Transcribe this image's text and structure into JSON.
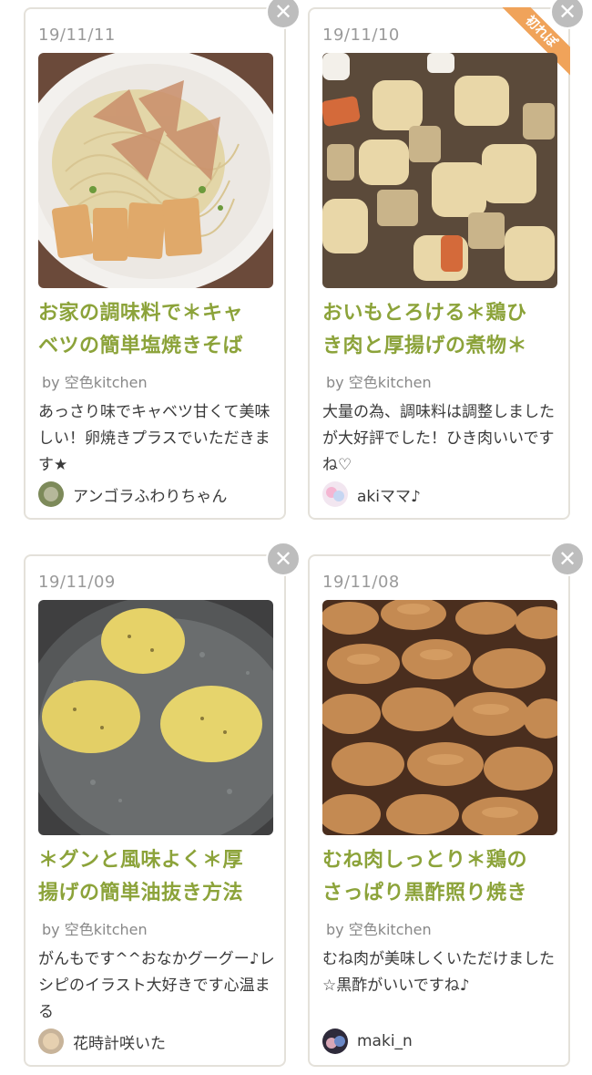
{
  "cards": [
    {
      "date": "19/11/11",
      "title_line1": "お家の調味料で＊キャ",
      "title_line2": "ベツの簡単塩焼きそば",
      "byline": "by 空色kitchen",
      "comment": "あっさり味でキャベツ甘くて美味しい！卵焼きプラスでいただきます★",
      "reporter": "アンゴラふわりちゃん",
      "photo_icon": "yakisoba-photo",
      "close": "✕"
    },
    {
      "date": "19/11/10",
      "title_line1": "おいもとろける＊鶏ひ",
      "title_line2": "き肉と厚揚げの煮物＊",
      "byline": "by 空色kitchen",
      "comment": "大量の為、調味料は調整しましたが大好評でした！ひき肉いいですね♡",
      "reporter": "akiママ♪",
      "badge": "初れぽ",
      "photo_icon": "nimono-photo",
      "close": "✕"
    },
    {
      "date": "19/11/09",
      "title_line1": "＊グンと風味よく＊厚",
      "title_line2": "揚げの簡単油抜き方法",
      "byline": "by 空色kitchen",
      "comment": "がんもです^^おなかグーグー♪レシピのイラスト大好きです心温まる",
      "reporter": "花時計咲いた",
      "photo_icon": "ganmo-pan-photo",
      "close": "✕"
    },
    {
      "date": "19/11/08",
      "title_line1": "むね肉しっとり＊鶏の",
      "title_line2": "さっぱり黒酢照り焼き",
      "byline": "by 空色kitchen",
      "comment": "むね肉が美味しくいただけました☆黒酢がいいですね♪",
      "reporter": "maki_n",
      "photo_icon": "chicken-photo",
      "close": "✕"
    }
  ],
  "colors": {
    "title": "#8ca33a",
    "date": "#9a9a9a",
    "close": "#bdbdbd",
    "badge": "#f0a35a"
  }
}
